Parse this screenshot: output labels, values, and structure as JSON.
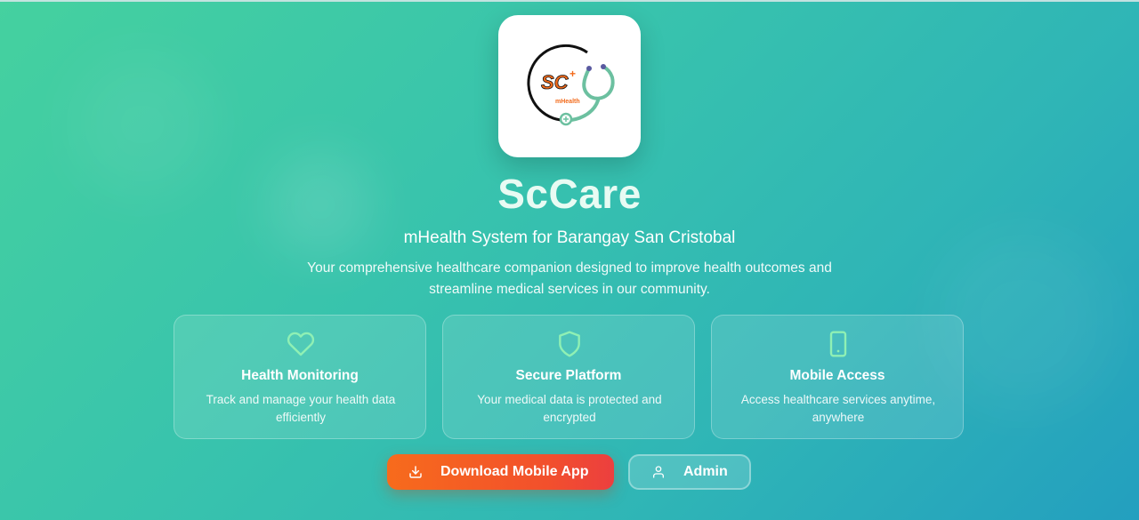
{
  "app": {
    "name": "ScCare",
    "subtitle": "mHealth System for Barangay San Cristobal",
    "description": "Your comprehensive healthcare companion designed to improve health outcomes and streamline medical services in our community."
  },
  "logo": {
    "badge_text": "SC",
    "caption": "mHealth",
    "icon": "stethoscope-icon"
  },
  "features": [
    {
      "icon": "heart-icon",
      "title": "Health Monitoring",
      "description": "Track and manage your health data efficiently"
    },
    {
      "icon": "shield-icon",
      "title": "Secure Platform",
      "description": "Your medical data is protected and encrypted"
    },
    {
      "icon": "smartphone-icon",
      "title": "Mobile Access",
      "description": "Access healthcare services anytime, anywhere"
    }
  ],
  "actions": {
    "download_label": "Download Mobile App",
    "download_icon": "download-icon",
    "admin_label": "Admin",
    "admin_icon": "user-icon"
  },
  "colors": {
    "accent_orange": "#f76b1c",
    "icon_green": "#8ff0b4",
    "logo_orange": "#f26a1b",
    "logo_teal": "#6cc0a0"
  }
}
